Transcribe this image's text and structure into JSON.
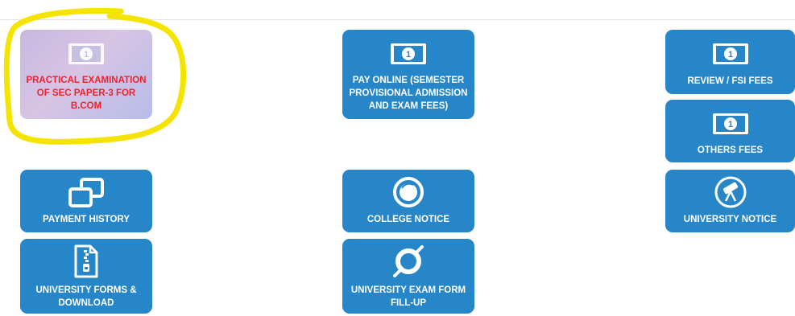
{
  "tiles": {
    "practical_exam": {
      "label": "PRACTICAL EXAMINATION OF SEC PAPER-3 FOR B.COM"
    },
    "pay_online": {
      "label": "PAY ONLINE (SEMESTER PROVISIONAL ADMISSION AND EXAM FEES)"
    },
    "review_fees": {
      "label": "REVIEW / FSI FEES"
    },
    "others_fees": {
      "label": "OTHERS FEES"
    },
    "payment_history": {
      "label": "PAYMENT HISTORY"
    },
    "college_notice": {
      "label": "COLLEGE NOTICE"
    },
    "university_notice": {
      "label": "UNIVERSITY NOTICE"
    },
    "university_forms": {
      "label": "UNIVERSITY FORMS & DOWNLOAD"
    },
    "exam_form": {
      "label": "UNIVERSITY EXAM FORM FILL-UP"
    }
  },
  "icons": {
    "money": "money-bill-icon",
    "windows": "overlapping-windows-icon",
    "circle": "circle-icon",
    "telescope": "telescope-icon",
    "zip": "zip-file-icon",
    "ring": "ring-icon"
  },
  "colors": {
    "tile": "#2686c8",
    "highlight": "#f4e400",
    "selected_text": "#f0222e"
  }
}
